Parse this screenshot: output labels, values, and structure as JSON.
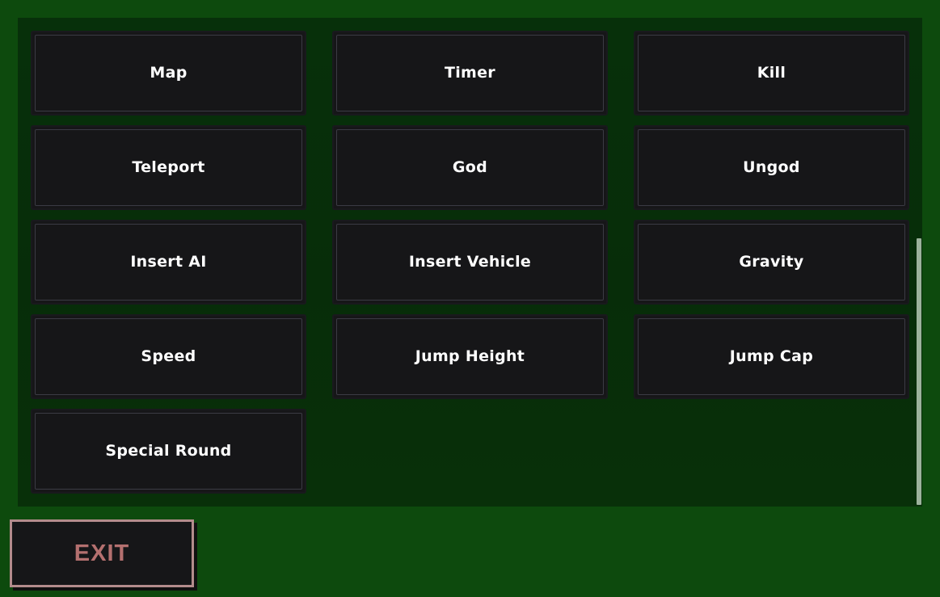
{
  "theme": {
    "background_color": "#0d4a0d",
    "panel_color": "#082f08",
    "button_fill": "#161618",
    "button_border": "#3b3b44",
    "button_text_color": "#ffffff",
    "exit_accent_color": "#b38c8c",
    "exit_text_color": "#b4706f",
    "scrollbar_thumb_color": "#9cb29c"
  },
  "menu": {
    "buttons": [
      {
        "label": "Map",
        "name": "map"
      },
      {
        "label": "Timer",
        "name": "timer"
      },
      {
        "label": "Kill",
        "name": "kill"
      },
      {
        "label": "Teleport",
        "name": "teleport"
      },
      {
        "label": "God",
        "name": "god"
      },
      {
        "label": "Ungod",
        "name": "ungod"
      },
      {
        "label": "Insert AI",
        "name": "insert-ai"
      },
      {
        "label": "Insert Vehicle",
        "name": "insert-vehicle"
      },
      {
        "label": "Gravity",
        "name": "gravity"
      },
      {
        "label": "Speed",
        "name": "speed"
      },
      {
        "label": "Jump Height",
        "name": "jump-height"
      },
      {
        "label": "Jump Cap",
        "name": "jump-cap"
      },
      {
        "label": "Special Round",
        "name": "special-round"
      }
    ]
  },
  "exit": {
    "label": "EXIT"
  }
}
